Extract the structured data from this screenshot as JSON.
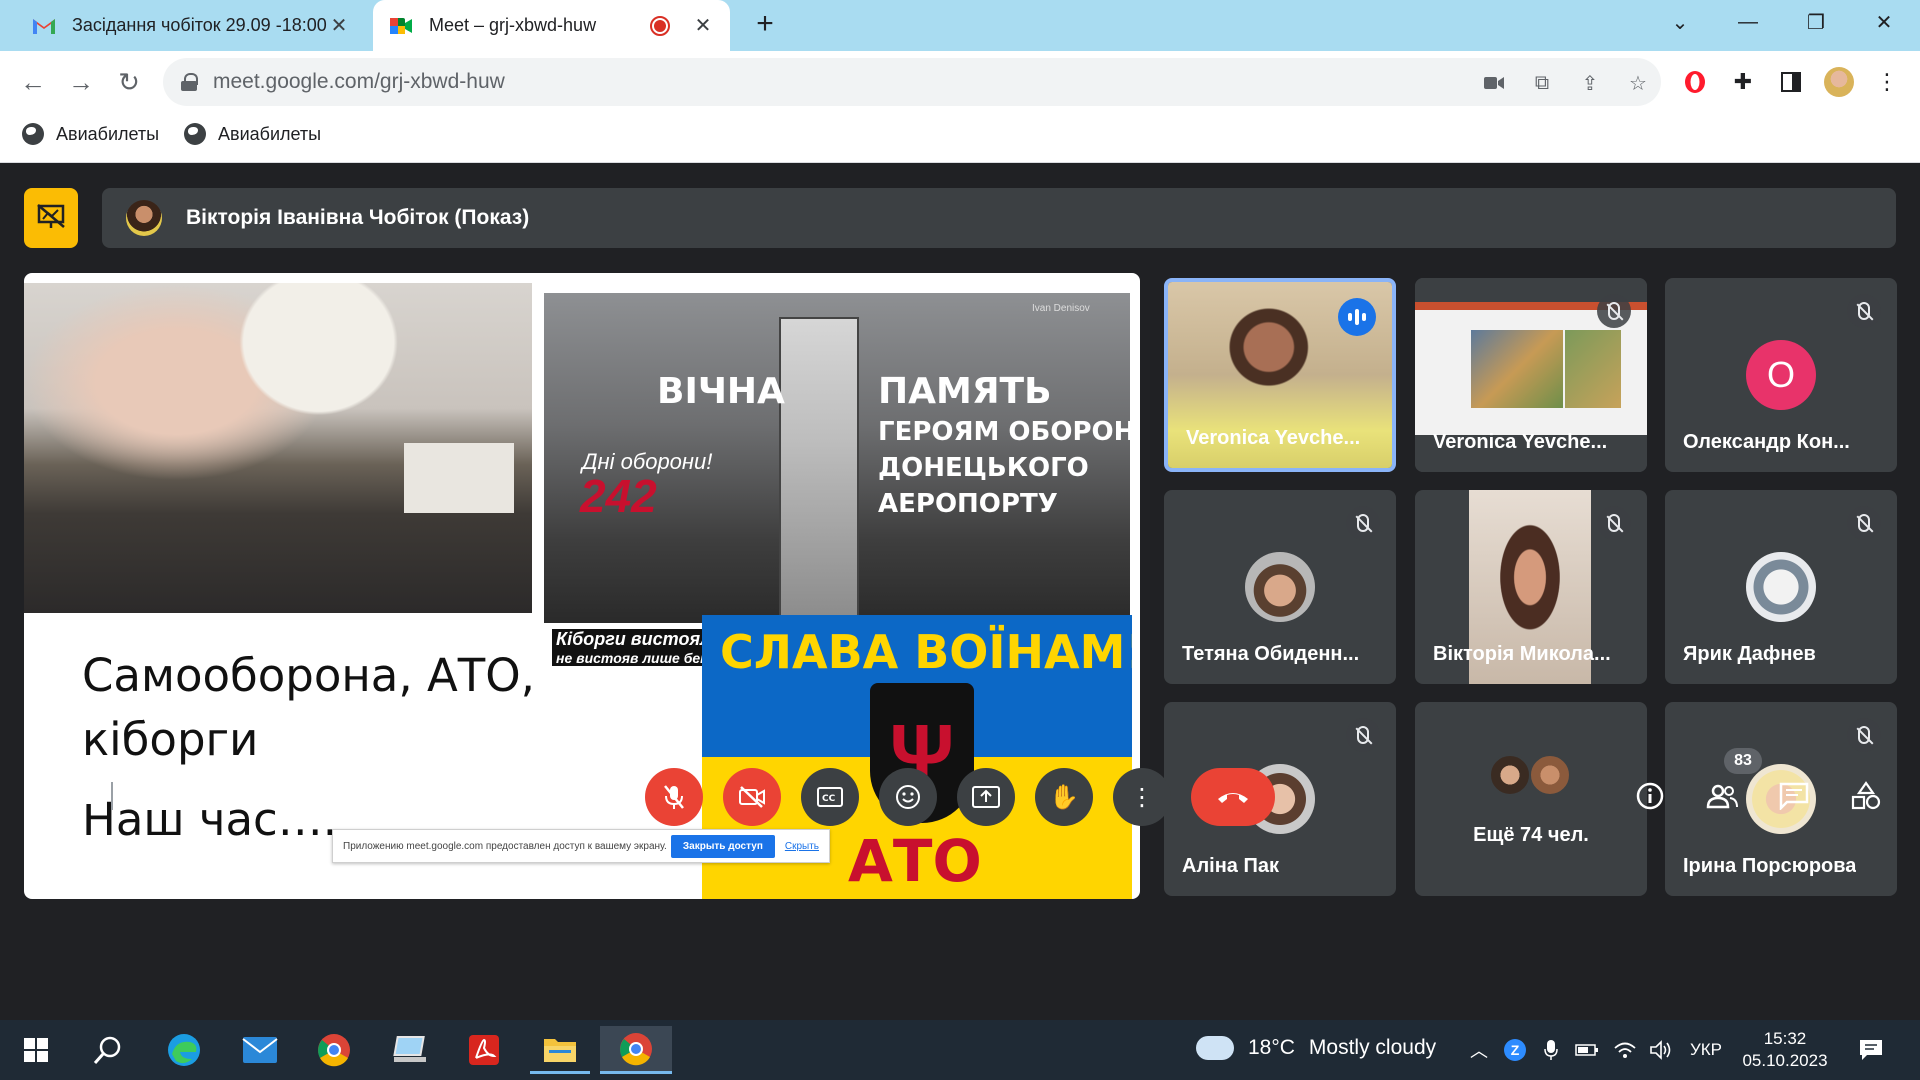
{
  "browser": {
    "tabs": [
      {
        "title": "Засідання чобіток 29.09 -18:00",
        "icon": "gmail-icon",
        "active": false
      },
      {
        "title": "Meet – grj-xbwd-huw",
        "icon": "meet-icon",
        "active": true
      }
    ],
    "url": "meet.google.com/grj-xbwd-huw",
    "bookmarks": [
      "Авиабилеты",
      "Авиабилеты"
    ]
  },
  "meet": {
    "presenter_name": "Вікторія Іванівна Чобіток (Показ)",
    "clock": "15:32",
    "meeting_code": "grj-xbwd-huw",
    "participant_count": "83",
    "slide": {
      "memorial_line1": "ВІЧНА",
      "memorial_line2": "ПАМЯТЬ",
      "memorial_sub1": "ГЕРОЯМ ОБОРОНИ",
      "memorial_sub2": "ДОНЕЦЬКОГО",
      "memorial_sub3": "АЕРОПОРТУ",
      "day_label": "Дні оборони!",
      "day_count": "242",
      "cyborg_line1": "Кіборги вистояли!",
      "cyborg_line2": "не вистояв лише бетон!",
      "author": "Ivan Denisov",
      "flag_title": "СЛАВА ВОЇНАМ!",
      "flag_bottom": "АТО",
      "text_line1": "Самооборона, АТО,",
      "text_line2": "кіборги",
      "text_line3": "Наш час….",
      "share_message": "Приложению meet.google.com предоставлен доступ к вашему экрану.",
      "share_stop": "Закрыть доступ",
      "share_hide": "Скрыть"
    },
    "participants": [
      {
        "name": "Veronica Yevche...",
        "speaking": true
      },
      {
        "name": "Veronica Yevche...",
        "speaking": false
      },
      {
        "name": "Олександр Кон...",
        "initial": "О",
        "avatar_color": "#e8336a"
      },
      {
        "name": "Тетяна Обиденн..."
      },
      {
        "name": "Вікторія Микола..."
      },
      {
        "name": "Ярик Дафнев"
      },
      {
        "name": "Аліна Пак"
      },
      {
        "name": "Ещё 74 чел."
      },
      {
        "name": "Ірина Порсюрова"
      }
    ]
  },
  "taskbar": {
    "weather_temp": "18°C",
    "weather_text": "Mostly cloudy",
    "language": "УКР",
    "time": "15:32",
    "date": "05.10.2023"
  },
  "colors": {
    "meet_bg": "#202124",
    "tile_bg": "#3c4043",
    "accent_red": "#ea4335",
    "present_yellow": "#fbbc04",
    "tab_strip": "#a9dcf1"
  }
}
